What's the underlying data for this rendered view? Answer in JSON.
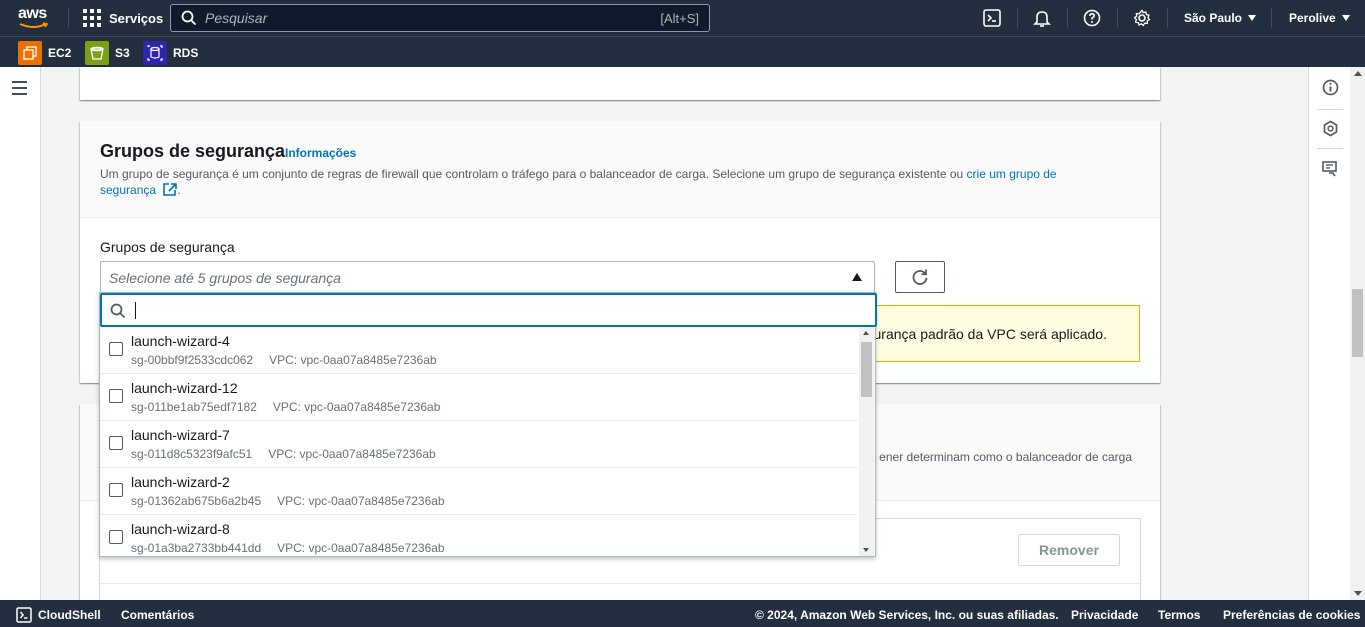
{
  "topnav": {
    "logo_text": "aws",
    "services_label": "Serviços",
    "search_placeholder": "Pesquisar",
    "search_shortcut": "[Alt+S]",
    "region": "São Paulo",
    "account": "Perolive"
  },
  "favorites": [
    {
      "label": "EC2",
      "color": "#ed7100"
    },
    {
      "label": "S3",
      "color": "#7aa116"
    },
    {
      "label": "RDS",
      "color": "#2e27ad"
    }
  ],
  "security_groups": {
    "title": "Grupos de segurança",
    "info_link": "Informações",
    "description_text": "Um grupo de segurança é um conjunto de regras de firewall que controlam o tráfego para o balanceador de carga. Selecione um grupo de segurança existente ou ",
    "description_link": "crie um grupo de segurança",
    "description_end": ".",
    "field_label": "Grupos de segurança",
    "select_placeholder": "Selecione até 5 grupos de segurança",
    "alert_text": "gurança padrão da VPC será aplicado."
  },
  "dropdown": {
    "items": [
      {
        "name": "launch-wizard-4",
        "id": "sg-00bbf9f2533cdc062",
        "vpc": "VPC: vpc-0aa07a8485e7236ab"
      },
      {
        "name": "launch-wizard-12",
        "id": "sg-011be1ab75edf7182",
        "vpc": "VPC: vpc-0aa07a8485e7236ab"
      },
      {
        "name": "launch-wizard-7",
        "id": "sg-011d8c5323f9afc51",
        "vpc": "VPC: vpc-0aa07a8485e7236ab"
      },
      {
        "name": "launch-wizard-2",
        "id": "sg-01362ab675b6a2b45",
        "vpc": "VPC: vpc-0aa07a8485e7236ab"
      },
      {
        "name": "launch-wizard-8",
        "id": "sg-01a3ba2733bb441dd",
        "vpc": "VPC: vpc-0aa07a8485e7236ab"
      }
    ]
  },
  "listener": {
    "description_fragment": "ener determinam como o balanceador de carga",
    "remove_label": "Remover"
  },
  "footer": {
    "cloudshell": "CloudShell",
    "feedback": "Comentários",
    "copyright": "© 2024, Amazon Web Services, Inc. ou suas afiliadas.",
    "privacy": "Privacidade",
    "terms": "Termos",
    "cookies": "Preferências de cookies"
  }
}
